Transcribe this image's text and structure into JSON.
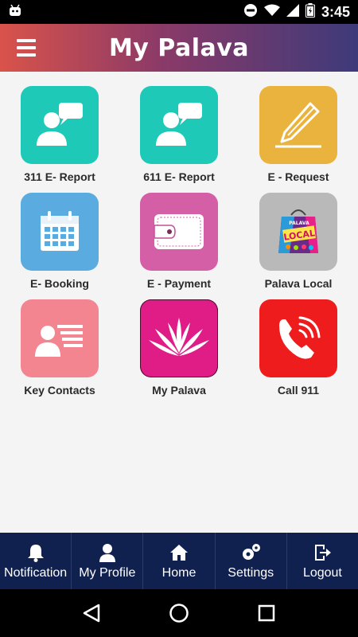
{
  "status_bar": {
    "time": "3:45",
    "icons": [
      "android-icon",
      "do-not-disturb-icon",
      "wifi-icon",
      "cell-signal-icon",
      "battery-icon"
    ]
  },
  "app_bar": {
    "title": "My Palava",
    "menu_icon": "hamburger-menu-icon"
  },
  "tiles": [
    {
      "label": "311 E- Report",
      "icon": "person-speech-icon",
      "color": "#1ec9b8"
    },
    {
      "label": "611 E- Report",
      "icon": "person-speech-icon",
      "color": "#1ec9b8"
    },
    {
      "label": "E - Request",
      "icon": "pencil-icon",
      "color": "#eab33d"
    },
    {
      "label": "E- Booking",
      "icon": "calendar-icon",
      "color": "#5aace0"
    },
    {
      "label": "E - Payment",
      "icon": "wallet-icon",
      "color": "#d45fa6"
    },
    {
      "label": "Palava Local",
      "icon": "shopping-bag-icon",
      "color": "#b9b9b9",
      "bag_text": "LOCAL",
      "bag_top_text": "PALAVA"
    },
    {
      "label": "Key Contacts",
      "icon": "contact-card-icon",
      "color": "#f2858f"
    },
    {
      "label": "My Palava",
      "icon": "lotus-logo-icon",
      "color": "#e01c87"
    },
    {
      "label": "Call 911",
      "icon": "phone-call-icon",
      "color": "#ee1c1c"
    }
  ],
  "bottom_nav": [
    {
      "label": "Notification",
      "icon": "bell-icon"
    },
    {
      "label": "My Profile",
      "icon": "user-icon"
    },
    {
      "label": "Home",
      "icon": "home-icon"
    },
    {
      "label": "Settings",
      "icon": "gears-icon"
    },
    {
      "label": "Logout",
      "icon": "logout-icon"
    }
  ],
  "system_nav": {
    "back": "back-triangle-icon",
    "home": "home-circle-icon",
    "recents": "recents-square-icon"
  },
  "colors": {
    "app_bar_start": "#d9534a",
    "app_bar_end": "#3d3a7a",
    "bottom_nav_bg": "#10214f",
    "background": "#f4f4f4"
  }
}
